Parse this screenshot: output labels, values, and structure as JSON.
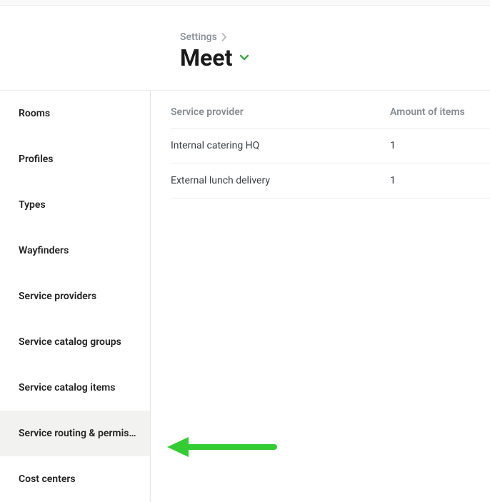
{
  "breadcrumb": {
    "label": "Settings"
  },
  "title": "Meet",
  "sidebar": {
    "items": [
      {
        "label": "Rooms"
      },
      {
        "label": "Profiles"
      },
      {
        "label": "Types"
      },
      {
        "label": "Wayfinders"
      },
      {
        "label": "Service providers"
      },
      {
        "label": "Service catalog groups"
      },
      {
        "label": "Service catalog items"
      },
      {
        "label": "Service routing & permissions"
      },
      {
        "label": "Cost centers"
      }
    ],
    "active_index": 7
  },
  "table": {
    "headers": {
      "provider": "Service provider",
      "amount": "Amount of items"
    },
    "rows": [
      {
        "provider": "Internal catering HQ",
        "amount": "1"
      },
      {
        "provider": "External lunch delivery",
        "amount": "1"
      }
    ]
  }
}
